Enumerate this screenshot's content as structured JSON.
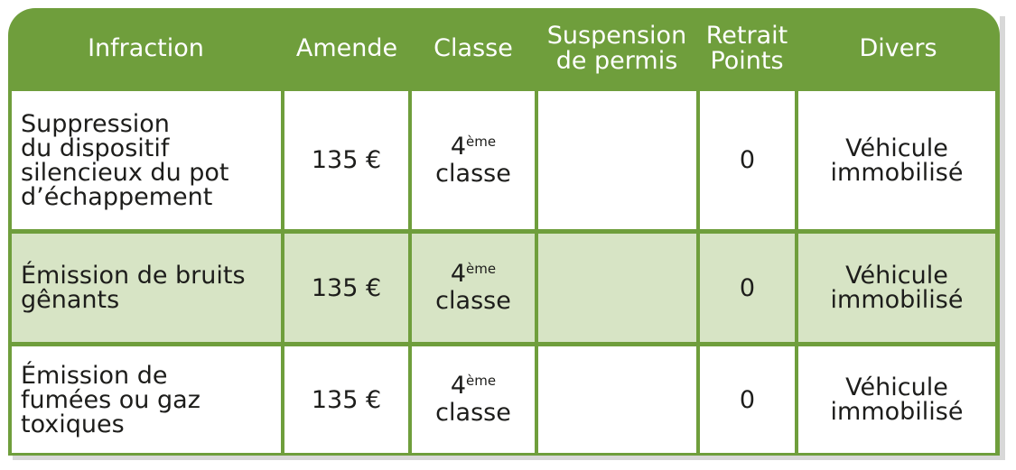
{
  "headers": {
    "infraction": "Infraction",
    "amende": "Amende",
    "classe": "Classe",
    "suspension_l1": "Suspension",
    "suspension_l2": "de permis",
    "retrait_l1": "Retrait",
    "retrait_l2": "Points",
    "divers": "Divers"
  },
  "rows": [
    {
      "infraction_lines": [
        "Suppression",
        "du dispositif",
        "silencieux du pot",
        "d’échappement"
      ],
      "amende": "135 €",
      "classe_num": "4",
      "classe_sup": "ème",
      "classe_word": "classe",
      "suspension": "",
      "points": "0",
      "divers_l1": "Véhicule",
      "divers_l2": "immobilisé"
    },
    {
      "infraction_lines": [
        "Émission de bruits",
        "gênants"
      ],
      "amende": "135 €",
      "classe_num": "4",
      "classe_sup": "ème",
      "classe_word": "classe",
      "suspension": "",
      "points": "0",
      "divers_l1": "Véhicule",
      "divers_l2": "immobilisé"
    },
    {
      "infraction_lines": [
        "Émission de",
        "fumées ou gaz",
        "toxiques"
      ],
      "amende": "135 €",
      "classe_num": "4",
      "classe_sup": "ème",
      "classe_word": "classe",
      "suspension": "",
      "points": "0",
      "divers_l1": "Véhicule",
      "divers_l2": "immobilisé"
    }
  ],
  "colors": {
    "header_green": "#6f9e3c",
    "shaded_row": "#d7e4c5",
    "text": "#1d1d1b"
  }
}
